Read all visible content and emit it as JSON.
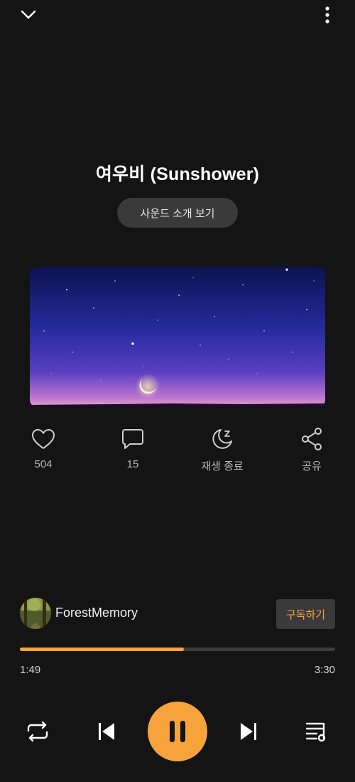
{
  "header": {
    "collapse_icon": "chevron-down-icon",
    "more_icon": "more-vertical-icon"
  },
  "track": {
    "title": "여우비 (Sunshower)",
    "intro_label": "사운드 소개 보기"
  },
  "actions": {
    "like_count": "504",
    "comment_count": "15",
    "sleep_timer_label": "재생 종료",
    "share_label": "공유"
  },
  "artist": {
    "name": "ForestMemory",
    "subscribe_label": "구독하기"
  },
  "playback": {
    "current_time": "1:49",
    "total_time": "3:30",
    "progress": 0.52,
    "state": "playing"
  },
  "colors": {
    "accent": "#f6a33b",
    "background": "#141414"
  }
}
